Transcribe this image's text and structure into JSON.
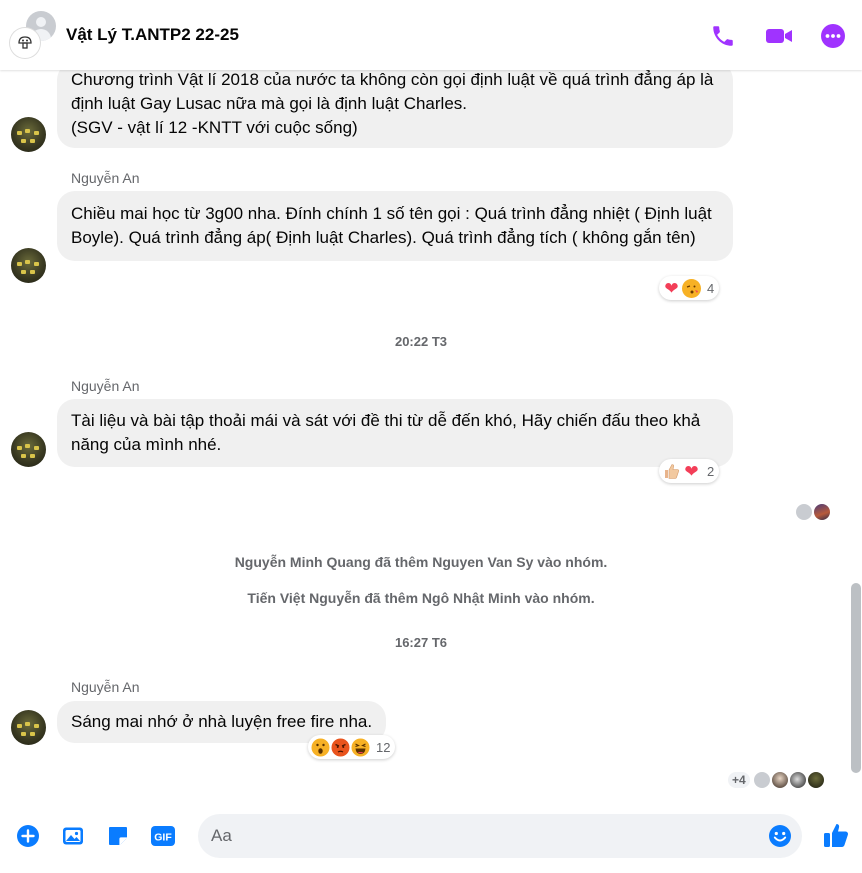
{
  "header": {
    "title": "Vật Lý T.ANTP2 22-25",
    "accent": "#a033ff"
  },
  "messages": [
    {
      "text": "Chương trình Vật lí 2018 của nước ta không còn gọi định luật về quá trình đẳng áp là định luật Gay Lusac nữa mà gọi là định luật Charles.\n(SGV - vật lí 12 -KNTT với cuộc sống)"
    },
    {
      "sender": "Nguyễn An",
      "text": "Chiều mai học từ 3g00 nha. Đính chính 1 số tên gọi : Quá trình đẳng nhiệt ( Định luật Boyle). Quá trình đẳng áp( Định luật Charles). Quá trình đẳng tích ( không gắn tên)",
      "reactions": [
        "heart",
        "kiss"
      ],
      "reaction_count": "4"
    },
    {
      "timestamp": "20:22 T3"
    },
    {
      "sender": "Nguyễn An",
      "text": "Tài liệu và bài tập thoải mái  và sát với đề thi từ dễ đến khó, Hãy chiến đấu theo khả năng của mình nhé.",
      "reactions": [
        "thumbs-up",
        "heart"
      ],
      "reaction_count": "2"
    },
    {
      "system": "Nguyễn Minh Quang đã thêm Nguyen Van Sy vào nhóm."
    },
    {
      "system": "Tiến Việt Nguyễn đã thêm Ngô Nhật Minh vào nhóm."
    },
    {
      "timestamp": "16:27 T6"
    },
    {
      "sender": "Nguyễn An",
      "text": "Sáng mai nhớ ở nhà luyện free fire nha.",
      "reactions": [
        "wow",
        "angry",
        "haha"
      ],
      "reaction_count": "12"
    }
  ],
  "seen_more": "+4",
  "composer": {
    "placeholder": "Aa"
  }
}
